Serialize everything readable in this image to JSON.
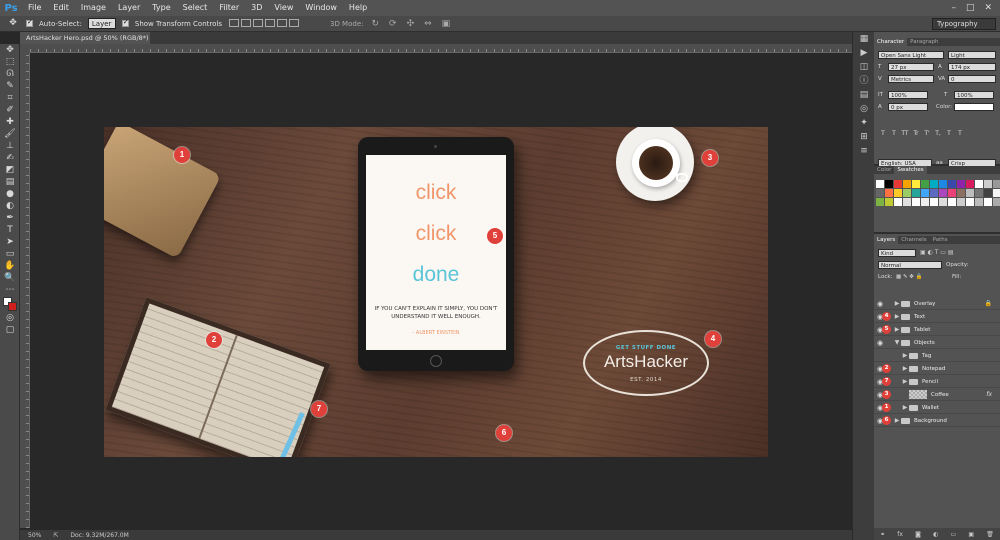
{
  "app": {
    "logo": "Ps"
  },
  "menu": [
    "File",
    "Edit",
    "Image",
    "Layer",
    "Type",
    "Select",
    "Filter",
    "3D",
    "View",
    "Window",
    "Help"
  ],
  "window_controls": [
    "–",
    "□",
    "✕"
  ],
  "options": {
    "auto_select_label": "Auto-Select:",
    "auto_select_value": "Layer",
    "transform_label": "Show Transform Controls",
    "mode3d_label": "3D Mode:",
    "workspace": "Typography"
  },
  "document": {
    "tab_title": "ArtsHacker Hero.psd @ 50% (RGB/8*) *",
    "zoom": "50%",
    "doc_size": "Doc: 9.32M/267.0M"
  },
  "canvas": {
    "tablet_words": [
      "click",
      "click",
      "done"
    ],
    "quote": "IF YOU CAN'T EXPLAIN IT SIMPLY, YOU DON'T UNDERSTAND IT WELL ENOUGH.",
    "quote_author": "- ALBERT EINSTEIN",
    "logo_tag": "GET STUFF DONE",
    "logo_name": "ArtsHacker",
    "logo_est": "EST. 2014",
    "badges": [
      "1",
      "2",
      "3",
      "4",
      "5",
      "6",
      "7"
    ]
  },
  "character_panel": {
    "tabs": [
      "Character",
      "Paragraph"
    ],
    "font_family": "Open Sans Light",
    "font_style": "Light",
    "font_size": "27 px",
    "leading": "174 px",
    "kerning": "Metrics",
    "tracking": "0",
    "vscale": "100%",
    "hscale": "100%",
    "baseline": "0 px",
    "color_label": "Color:",
    "type_buttons": [
      "T",
      "T",
      "TT",
      "Tr",
      "T'",
      "T,",
      "T",
      "T"
    ],
    "language": "English: USA",
    "aa_label": "aa",
    "antialias": "Crisp"
  },
  "swatches_panel": {
    "tabs": [
      "Color",
      "Swatches"
    ],
    "colors": [
      "#ffffff",
      "#000000",
      "#e53935",
      "#f4a300",
      "#ffeb3b",
      "#43a047",
      "#00acc1",
      "#1e88e5",
      "#3949ab",
      "#8e24aa",
      "#d81b60",
      "#ffffff",
      "#cccccc",
      "#999999",
      "#666666",
      "#ff7043",
      "#ffca28",
      "#9ccc65",
      "#26a69a",
      "#42a5f5",
      "#5c6bc0",
      "#ab47bc",
      "#ec407a",
      "#8d6e63",
      "#bdbdbd",
      "#757575",
      "#424242",
      "#f5f5f5",
      "#7cb342",
      "#c0ca33",
      "#ffffff",
      "#e0e0e0",
      "#ffffff",
      "#eeeeee",
      "#ffffff",
      "#dddddd",
      "#ffffff",
      "#cccccc",
      "#ffffff",
      "#bbbbbb",
      "#ffffff",
      "#aaaaaa"
    ]
  },
  "layers_panel": {
    "tabs": [
      "Layers",
      "Channels",
      "Paths"
    ],
    "kind": "Kind",
    "blend": "Normal",
    "opacity_label": "Opacity:",
    "lock_label": "Lock:",
    "fill_label": "Fill:",
    "rows": [
      {
        "name": "Overlay",
        "badge": "",
        "kind": "folder",
        "indent": 0,
        "lock": true
      },
      {
        "name": "Text",
        "badge": "4",
        "kind": "folder",
        "indent": 0
      },
      {
        "name": "Tablet",
        "badge": "5",
        "kind": "folder",
        "indent": 0
      },
      {
        "name": "Objects",
        "badge": "",
        "kind": "folder",
        "indent": 0,
        "open": true
      },
      {
        "name": "Tag",
        "badge": "",
        "kind": "folder",
        "indent": 1,
        "hidden": true
      },
      {
        "name": "Notepad",
        "badge": "2",
        "kind": "folder",
        "indent": 1
      },
      {
        "name": "Pencil",
        "badge": "7",
        "kind": "folder",
        "indent": 1
      },
      {
        "name": "Coffee",
        "badge": "3",
        "kind": "thumb",
        "indent": 1,
        "fx": true
      },
      {
        "name": "Wallet",
        "badge": "1",
        "kind": "folder",
        "indent": 1
      },
      {
        "name": "Background",
        "badge": "6",
        "kind": "folder",
        "indent": 0
      }
    ]
  },
  "icons": {
    "move": "move-icon",
    "marquee": "marquee-icon",
    "lasso": "lasso-icon",
    "eye": "eye-icon",
    "folder": "folder-icon",
    "lock": "lock-icon"
  },
  "colors": {
    "badge": "#e0403a",
    "accent_blue": "#5ac4d8",
    "accent_orange": "#f0966a"
  }
}
